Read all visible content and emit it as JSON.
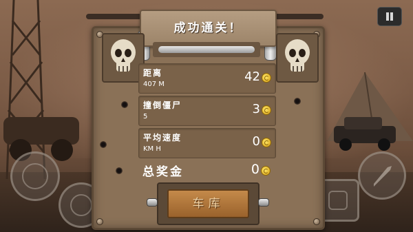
{
  "title": "成功通关！",
  "stats": [
    {
      "label": "距离",
      "sub": "407 M",
      "value": "42"
    },
    {
      "label": "撞倒僵尸",
      "sub": "5",
      "value": "3"
    },
    {
      "label": "平均速度",
      "sub": "KM H",
      "value": "0"
    }
  ],
  "total": {
    "label": "总奖金",
    "value": "0"
  },
  "garage_button": "车库",
  "colors": {
    "panel": "#8a7157",
    "coin": "#f2c21b",
    "button": "#b57a3f"
  },
  "icons": [
    "skull-icon",
    "coin-icon",
    "pause-icon",
    "joystick-icon",
    "rocket-icon",
    "brake-icon"
  ]
}
